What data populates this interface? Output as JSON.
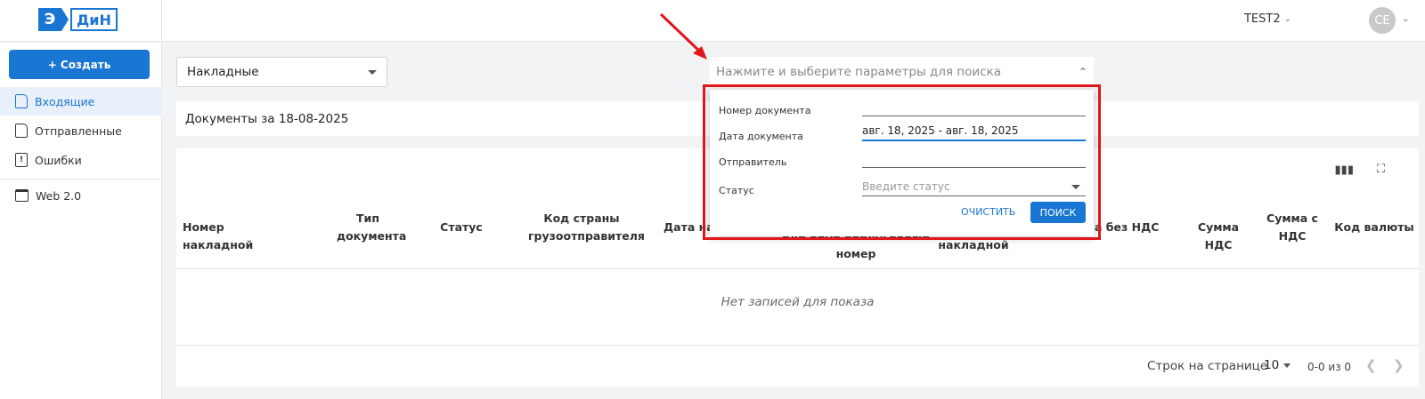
{
  "header": {
    "logo_e": "Э",
    "logo_din": "ДиН",
    "user_name": "TEST2",
    "avatar_initials": "CE"
  },
  "sidebar": {
    "create_label": "+ Создать",
    "items": [
      {
        "label": "Входящие",
        "icon": "incoming-doc-icon"
      },
      {
        "label": "Отправленные",
        "icon": "outgoing-doc-icon"
      },
      {
        "label": "Ошибки",
        "icon": "error-icon"
      },
      {
        "label": "Web 2.0",
        "icon": "window-icon"
      }
    ]
  },
  "main": {
    "doc_type_select": "Накладные",
    "search_placeholder": "Нажмите и выберите параметры для поиска",
    "docs_title": "Документы за 18-08-2025",
    "columns": [
      "Номер накладной",
      "Тип документа",
      "Статус",
      "Код страны грузоотправителя",
      "Дата нак",
      "или иной аналогичный номер",
      "накладной",
      "а без НДС",
      "Сумма НДС",
      "Сумма с НДС",
      "Код валюты"
    ],
    "empty_text": "Нет записей для показа",
    "rows_per_page_label": "Строк на странице",
    "rows_per_page_value": "10",
    "range_text": "0-0 из 0"
  },
  "search_popup": {
    "fields": [
      {
        "label": "Номер документа",
        "value": ""
      },
      {
        "label": "Дата документа",
        "value": "авг. 18, 2025 - авг. 18, 2025"
      },
      {
        "label": "Отправитель",
        "value": ""
      },
      {
        "label": "Статус",
        "placeholder": "Введите статус"
      }
    ],
    "clear_label": "ОЧИСТИТЬ",
    "search_label": "ПОИСК"
  },
  "colors": {
    "accent": "#1976d2",
    "highlight": "#e0161b"
  }
}
